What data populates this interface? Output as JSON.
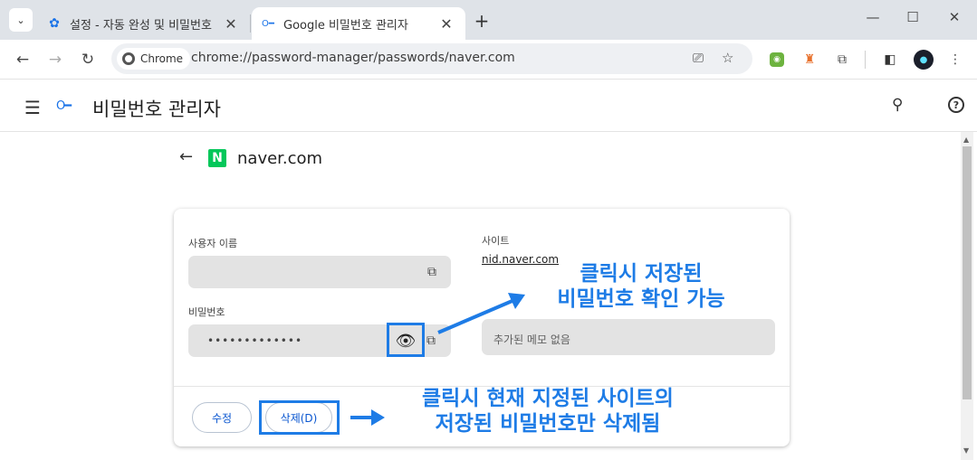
{
  "browser": {
    "tabs": [
      {
        "label": "설정 - 자동 완성 및 비밀번호",
        "icon": "gear-icon"
      },
      {
        "label": "Google 비밀번호 관리자",
        "icon": "key-icon"
      }
    ],
    "chip_label": "Chrome",
    "url": "chrome://password-manager/passwords/naver.com"
  },
  "header": {
    "title": "비밀번호 관리자"
  },
  "site": {
    "logo_letter": "N",
    "name": "naver.com",
    "brand_color": "#03c75a"
  },
  "card": {
    "username_label": "사용자 이름",
    "username_value": "",
    "password_label": "비밀번호",
    "password_value": "•••••••••••••",
    "site_label": "사이트",
    "site_link": "nid.naver.com",
    "note_placeholder": "추가된 메모 없음",
    "edit_label": "수정",
    "delete_label": "삭제(D)"
  },
  "annotations": {
    "eye_line1": "클릭시 저장된",
    "eye_line2": "비밀번호 확인 가능",
    "delete_line1": "클릭시 현재 지정된 사이트의",
    "delete_line2": "저장된 비밀번호만 삭제됨",
    "color": "#1e7ce6"
  }
}
